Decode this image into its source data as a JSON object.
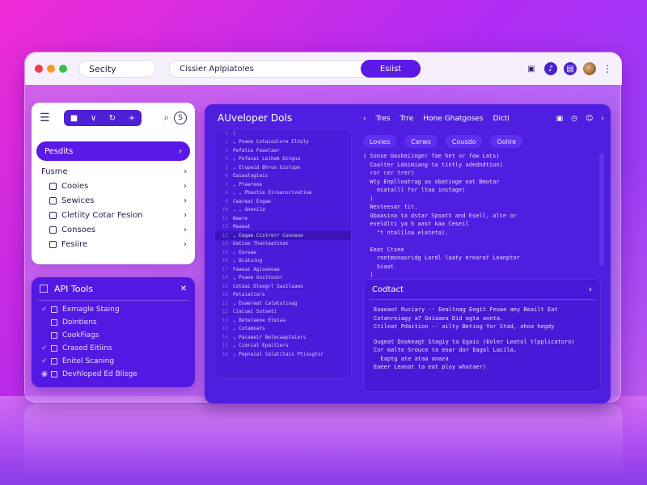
{
  "colors": {
    "accent": "#5a19e6",
    "dot_red": "#ee3b4f",
    "dot_orange": "#f59b23",
    "dot_green": "#36c24a"
  },
  "titlebar": {
    "app_label": "Secity",
    "search_value": "Cissier Aplpiatoles",
    "search_button": "Esiist",
    "icons": [
      "image-icon",
      "bell-icon",
      "document-icon"
    ]
  },
  "nav": {
    "tools": [
      "square-icon",
      "filter-icon",
      "refresh-icon",
      "plus-icon"
    ],
    "active_item": "Pesdits",
    "section_label": "Fusme",
    "items": [
      {
        "label": "Cooies",
        "icon": "folder-icon"
      },
      {
        "label": "Sewices",
        "icon": "server-icon"
      },
      {
        "label": "Cletiity Cotar Fesion",
        "icon": "layers-icon"
      },
      {
        "label": "Consoes",
        "icon": "console-icon"
      },
      {
        "label": "Fesiire",
        "icon": "file-icon"
      }
    ]
  },
  "api": {
    "title": "API Tools",
    "items": [
      {
        "label": "Exmagle Staing",
        "checked": true
      },
      {
        "label": "Dointiens",
        "checked": false
      },
      {
        "label": "CookFiags",
        "checked": false
      },
      {
        "label": "Crased Eitiins",
        "checked": true
      },
      {
        "label": "Enitel Scaning",
        "checked": true
      },
      {
        "label": "Devhloped Ed Blisge",
        "checked": false
      }
    ]
  },
  "main": {
    "title": "AUveloper Dols",
    "tabs": [
      "Tres",
      "Trre",
      "Hone Ghatgoses",
      "Dicti"
    ],
    "sub_tabs": [
      "Lovies",
      "Cerws",
      "Cousdo",
      "Oolire"
    ],
    "tree": [
      {
        "num": "1",
        "text": "("
      },
      {
        "num": "2",
        "text": "⌄ Poaoe Cotaioslore Eltely"
      },
      {
        "num": "3",
        "text": "  Pefatie Feaelaer"
      },
      {
        "num": "4",
        "text": "  ⌄ Pefasai Leihek Ditgna"
      },
      {
        "num": "5",
        "text": "  ⌄ Elupeid Bhroo Giolope"
      },
      {
        "num": "6",
        "text": "    Eaiaalagiais"
      },
      {
        "num": "7",
        "text": "  ⌄ Pleereoe"
      },
      {
        "num": "8",
        "text": "⌄ ⌄ Pbaotie Eireacorivatioe"
      },
      {
        "num": "9",
        "text": "    Ceareat Engae"
      },
      {
        "num": "10",
        "text": "  ⌄ ⌄ Gnonila"
      },
      {
        "num": "11",
        "text": "      Naere"
      },
      {
        "num": "12",
        "text": "      Maaaat"
      },
      {
        "num": "13",
        "text": "    ⌄ Eagae Cistrerr Cuoneoe",
        "hl": true
      },
      {
        "num": "14",
        "text": "      Datioe Thantaatinat"
      },
      {
        "num": "15",
        "text": "    ⌄ Eereae"
      },
      {
        "num": "16",
        "text": "  ⌄ Bcatuing"
      },
      {
        "num": "17",
        "text": "    Faaeai Agiooeoaa"
      },
      {
        "num": "18",
        "text": "  ⌄ Poaoe Gosttooor"
      },
      {
        "num": "19",
        "text": "    Cotaai Dleogrl Sastlsaeo"
      },
      {
        "num": "10",
        "text": "    Pelaiatiors"
      },
      {
        "num": "11",
        "text": "  ⌄ Eoaereat Catatolinag"
      },
      {
        "num": "12",
        "text": "    Ciaiuai Sutoeti"
      },
      {
        "num": "13",
        "text": "  ⌄ Betetaeoe Eteiaa"
      },
      {
        "num": "13",
        "text": "  ⌄ Cotamoats"
      },
      {
        "num": "14",
        "text": "  ⌄ Pacaeeir Betecaaptaiers"
      },
      {
        "num": "15",
        "text": "  ⌄ Cimriat Epaitiers"
      },
      {
        "num": "16",
        "text": "  ⌄ Pepnaial Salatitais Ptisugtor"
      }
    ],
    "code": [
      "( Sonse Gasbeiinger fae het or fow Lats)",
      "  Coalter Ldaimiang ta tintly adedndtion)",
      "  ror cer trer)",
      "  Wty Enplloatrag as obatioge eat Bmotar",
      "    ecatalll for ltaa instage)",
      "  )",
      "  Nesteesar tit.",
      "  Gbaasina ta dstar Spoatt and Esell, alte or",
      "  eveldlti ya h aast kaa Ceseil",
      "    \"t ntaliloa elateta).",
      "",
      "  Eeat Ctsee",
      "    rnetmonaoridg Lardl laaty erearaf Leanptor",
      "    Scaat.",
      "  )"
    ],
    "output": {
      "title": "Codtact",
      "lines_a": [
        "Eoaeaot Ruciary -- Eealtnag Eegit Feuae any Beailt Eat",
        "Cotanreiagy a7 Gniaaea Did ogta annta.",
        "Ctileat Pdaition -- ailty Betiog Yor Stad, ahoa hegdy"
      ],
      "lines_b": [
        "Ougeat Doakeagt Stagiy ta Egais (Eoler Leatol tlpplicatoro)",
        "Cor malte Srouce ta eoar dor Eagal Lacila,",
        "  Eaptg ate ataa anaza",
        "Eaeer Leanat ta eat ploy whataer)"
      ]
    }
  }
}
